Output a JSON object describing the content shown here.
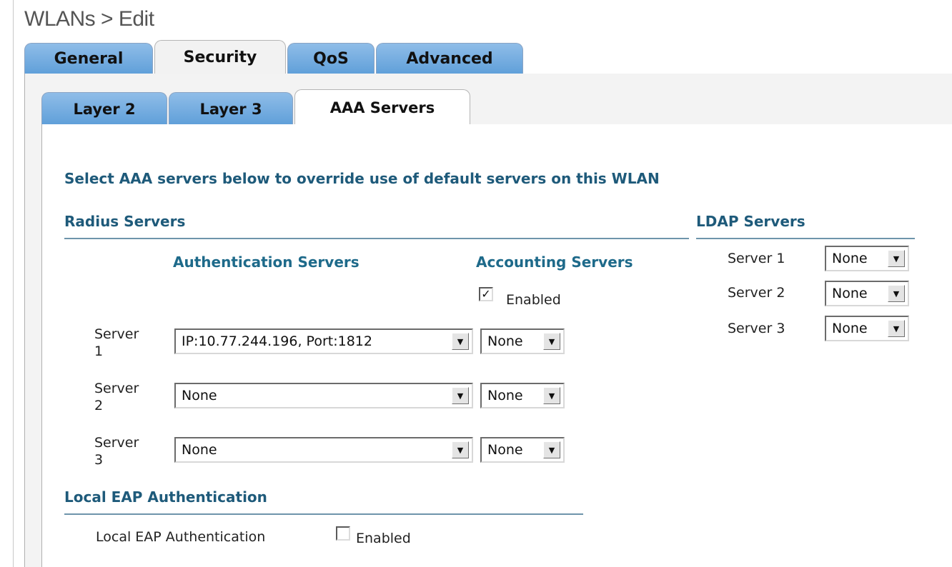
{
  "page": {
    "title": "WLANs > Edit"
  },
  "main_tabs": [
    {
      "label": "General"
    },
    {
      "label": "Security"
    },
    {
      "label": "QoS"
    },
    {
      "label": "Advanced"
    }
  ],
  "sub_tabs": [
    {
      "label": "Layer 2"
    },
    {
      "label": "Layer 3"
    },
    {
      "label": "AAA Servers"
    }
  ],
  "aaa": {
    "instruction": "Select AAA servers below to override use of default servers on this WLAN",
    "radius": {
      "heading": "Radius Servers",
      "auth_header": "Authentication Servers",
      "acct_header": "Accounting Servers",
      "acct_enabled_label": "Enabled",
      "acct_enabled_checked": true,
      "rows": [
        {
          "label": "Server",
          "num": "1",
          "auth": "IP:10.77.244.196, Port:1812",
          "acct": "None"
        },
        {
          "label": "Server",
          "num": "2",
          "auth": "None",
          "acct": "None"
        },
        {
          "label": "Server",
          "num": "3",
          "auth": "None",
          "acct": "None"
        }
      ]
    },
    "ldap": {
      "heading": "LDAP Servers",
      "rows": [
        {
          "label": "Server 1",
          "value": "None"
        },
        {
          "label": "Server 2",
          "value": "None"
        },
        {
          "label": "Server 3",
          "value": "None"
        }
      ]
    },
    "local_eap": {
      "heading": "Local EAP Authentication",
      "label": "Local EAP Authentication",
      "enabled_label": "Enabled",
      "checked": false
    },
    "check_mark": "✓",
    "dropdown_arrow": "▼"
  }
}
